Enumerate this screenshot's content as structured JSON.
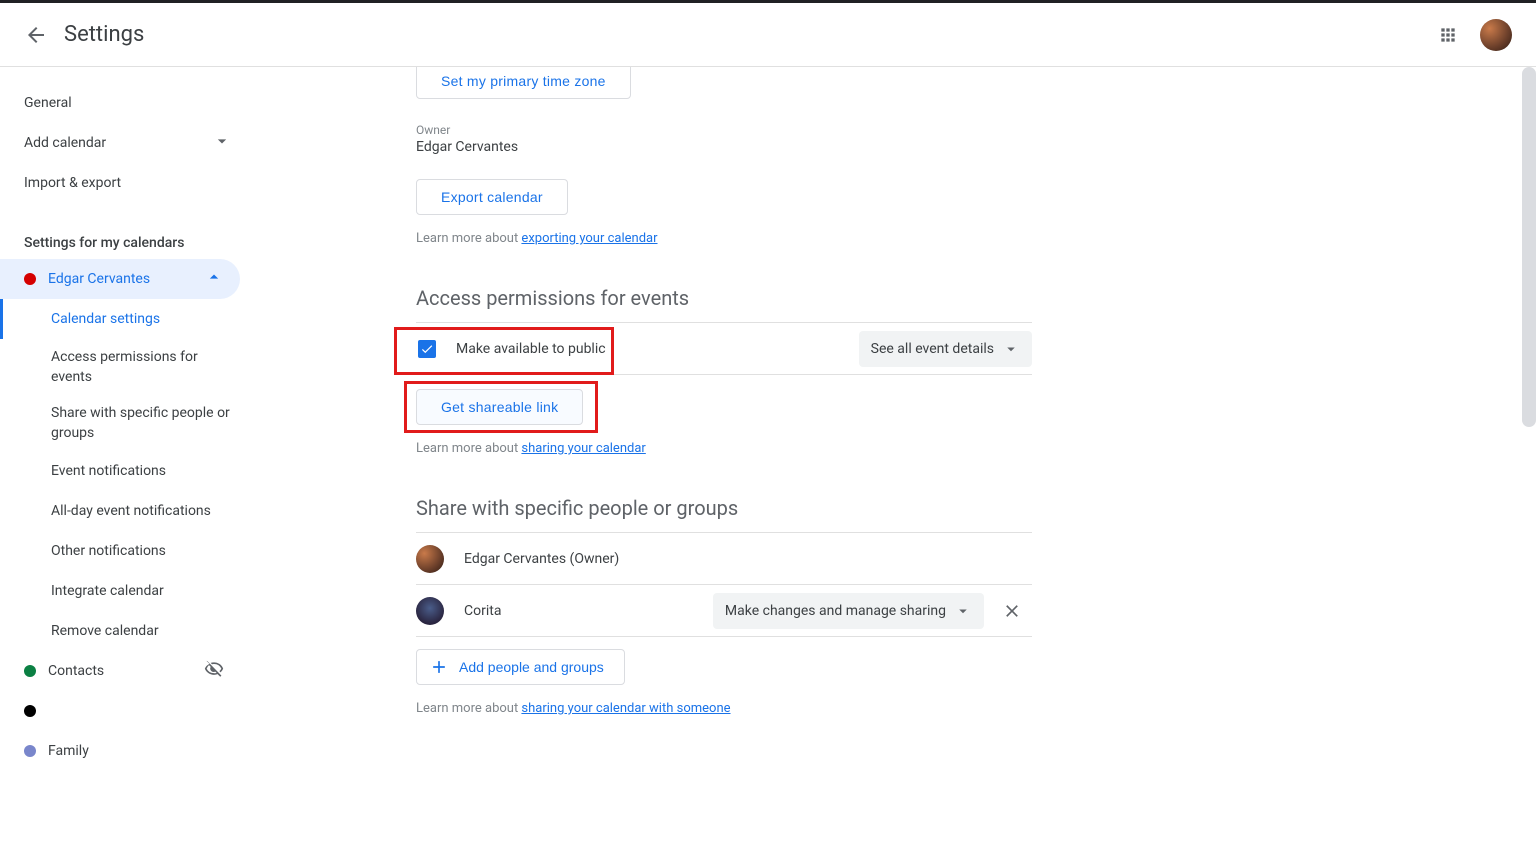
{
  "app": {
    "title": "Settings"
  },
  "sidebar": {
    "items": {
      "general": "General",
      "add_calendar": "Add calendar",
      "import_export": "Import & export"
    },
    "section_header": "Settings for my calendars",
    "calendars": [
      {
        "name": "Edgar Cervantes",
        "color": "#d50000",
        "expanded": true,
        "sub": [
          "Calendar settings",
          "Access permissions for events",
          "Share with specific people or groups",
          "Event notifications",
          "All-day event notifications",
          "Other notifications",
          "Integrate calendar",
          "Remove calendar"
        ],
        "active_sub": 0
      },
      {
        "name": "Contacts",
        "color": "#0b8043",
        "hidden_icon": true
      },
      {
        "name": "",
        "color": "#000000"
      },
      {
        "name": "Family",
        "color": "#7986cb"
      }
    ]
  },
  "main": {
    "set_tz_btn": "Set my primary time zone",
    "owner_label": "Owner",
    "owner_name": "Edgar Cervantes",
    "export_btn": "Export calendar",
    "learn_export_pre": "Learn more about ",
    "learn_export_link": "exporting your calendar",
    "access": {
      "heading": "Access permissions for events",
      "public_label": "Make available to public",
      "public_checked": true,
      "detail_dropdown": "See all event details",
      "share_link_btn": "Get shareable link",
      "learn_pre": "Learn more about ",
      "learn_link": "sharing your calendar"
    },
    "share": {
      "heading": "Share with specific people or groups",
      "people": [
        {
          "name": "Edgar Cervantes (Owner)",
          "perm": null,
          "removable": false
        },
        {
          "name": "Corita",
          "perm": "Make changes and manage sharing",
          "removable": true
        }
      ],
      "add_btn": "Add people and groups",
      "learn_pre": "Learn more about ",
      "learn_link": "sharing your calendar with someone"
    }
  }
}
